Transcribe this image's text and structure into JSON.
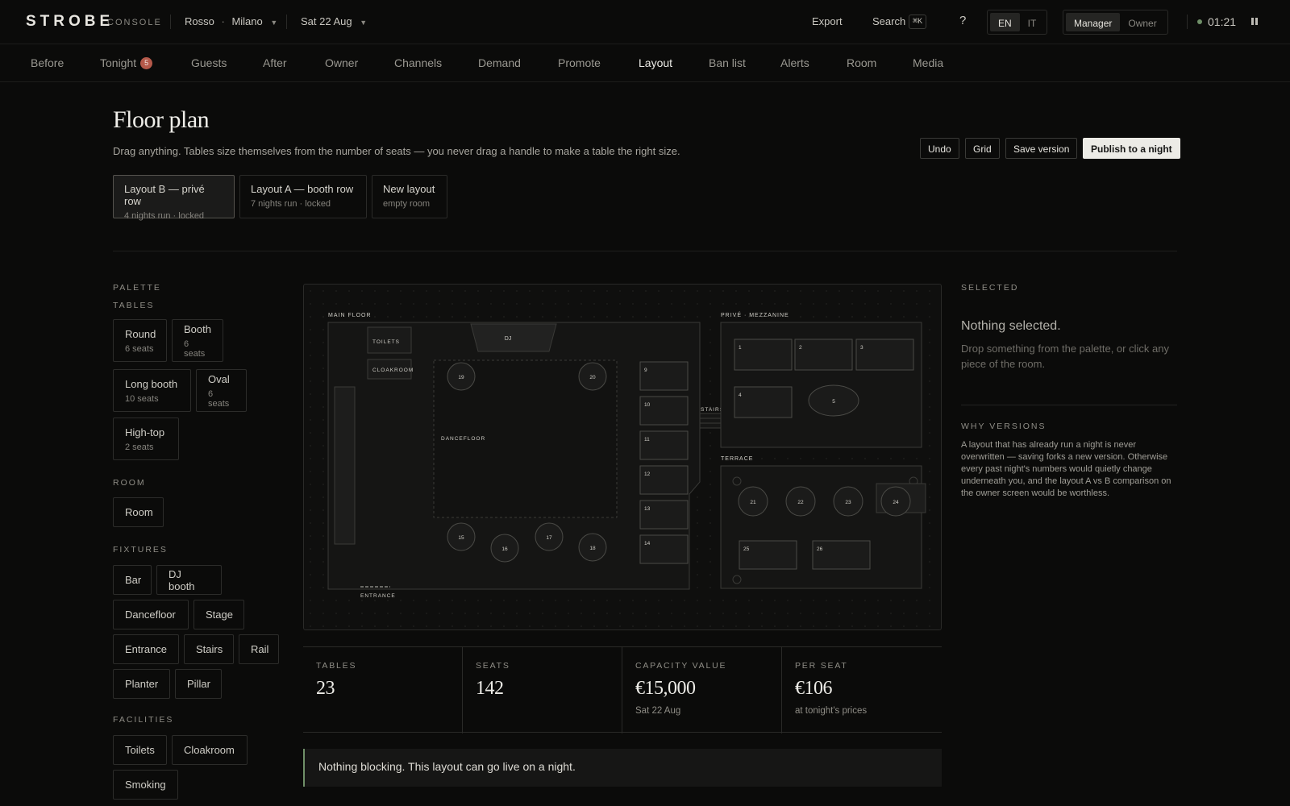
{
  "brand": {
    "name": "STROBE",
    "sub": "CONSOLE"
  },
  "venue": {
    "name": "Rosso",
    "dot": "·",
    "city": "Milano"
  },
  "date_selector": "Sat 22 Aug",
  "topbar": {
    "export": "Export",
    "search": "Search",
    "search_kbd": "⌘K",
    "help": "?",
    "lang": [
      "EN",
      "IT"
    ],
    "lang_active": "EN",
    "roles": [
      "Manager",
      "Owner"
    ],
    "role_active": "Manager",
    "clock": "01:21"
  },
  "nav": {
    "items": [
      "Before",
      "Tonight",
      "Guests",
      "After",
      "Owner",
      "Channels",
      "Demand",
      "Promote",
      "Layout",
      "Ban list",
      "Alerts",
      "Room",
      "Media"
    ],
    "tonight_badge": "5",
    "active": "Layout"
  },
  "page": {
    "title": "Floor plan",
    "description": "Drag anything. Tables size themselves from the number of seats — you never drag a handle to make a table the right size.",
    "actions": {
      "undo": "Undo",
      "grid": "Grid",
      "save": "Save version",
      "publish": "Publish to a night"
    }
  },
  "layouts": [
    {
      "name": "Layout B — privé row",
      "sub": "4 nights run · locked",
      "active": true
    },
    {
      "name": "Layout A — booth row",
      "sub": "7 nights run · locked",
      "active": false
    },
    {
      "name": "New layout",
      "sub": "empty room",
      "active": false
    }
  ],
  "palette": {
    "title": "PALETTE",
    "tables_label": "TABLES",
    "tables": [
      {
        "name": "Round",
        "sub": "6 seats"
      },
      {
        "name": "Booth",
        "sub": "6 seats"
      },
      {
        "name": "Long booth",
        "sub": "10 seats"
      },
      {
        "name": "Oval",
        "sub": "6 seats"
      },
      {
        "name": "High-top",
        "sub": "2 seats"
      }
    ],
    "room_label": "ROOM",
    "room": [
      "Room"
    ],
    "fixtures_label": "FIXTURES",
    "fixtures": [
      "Bar",
      "DJ booth",
      "Dancefloor",
      "Stage",
      "Entrance",
      "Stairs",
      "Rail",
      "Planter",
      "Pillar"
    ],
    "facilities_label": "FACILITIES",
    "facilities": [
      "Toilets",
      "Cloakroom",
      "Smoking"
    ]
  },
  "floor": {
    "main_floor": "MAIN FLOOR",
    "prive": "PRIVÉ · MEZZANINE",
    "terrace": "TERRACE",
    "toilets": "TOILETS",
    "cloakroom": "CLOAKROOM",
    "dj": "DJ",
    "dancefloor": "DANCEFLOOR",
    "stairs": "STAIRS",
    "entrance": "ENTRANCE",
    "round_tables": [
      "19",
      "20",
      "15",
      "16",
      "17",
      "18"
    ],
    "main_booths": [
      "9",
      "10",
      "11",
      "12",
      "13",
      "14"
    ],
    "prive_tables": [
      "1",
      "2",
      "3",
      "4",
      "5"
    ],
    "terrace_tables": [
      "21",
      "22",
      "23",
      "24",
      "25",
      "26"
    ]
  },
  "selected": {
    "label": "SELECTED",
    "title": "Nothing selected.",
    "desc": "Drop something from the palette, or click any piece of the room."
  },
  "why": {
    "label": "WHY VERSIONS",
    "text": "A layout that has already run a night is never overwritten — saving forks a new version. Otherwise every past night's numbers would quietly change underneath you, and the layout A vs B comparison on the owner screen would be worthless."
  },
  "stats": [
    {
      "label": "TABLES",
      "value": "23",
      "sub": ""
    },
    {
      "label": "SEATS",
      "value": "142",
      "sub": ""
    },
    {
      "label": "CAPACITY VALUE",
      "value": "€15,000",
      "sub": "Sat 22 Aug"
    },
    {
      "label": "PER SEAT",
      "value": "€106",
      "sub": "at tonight's prices"
    }
  ],
  "notice": "Nothing blocking. This layout can go live on a night."
}
